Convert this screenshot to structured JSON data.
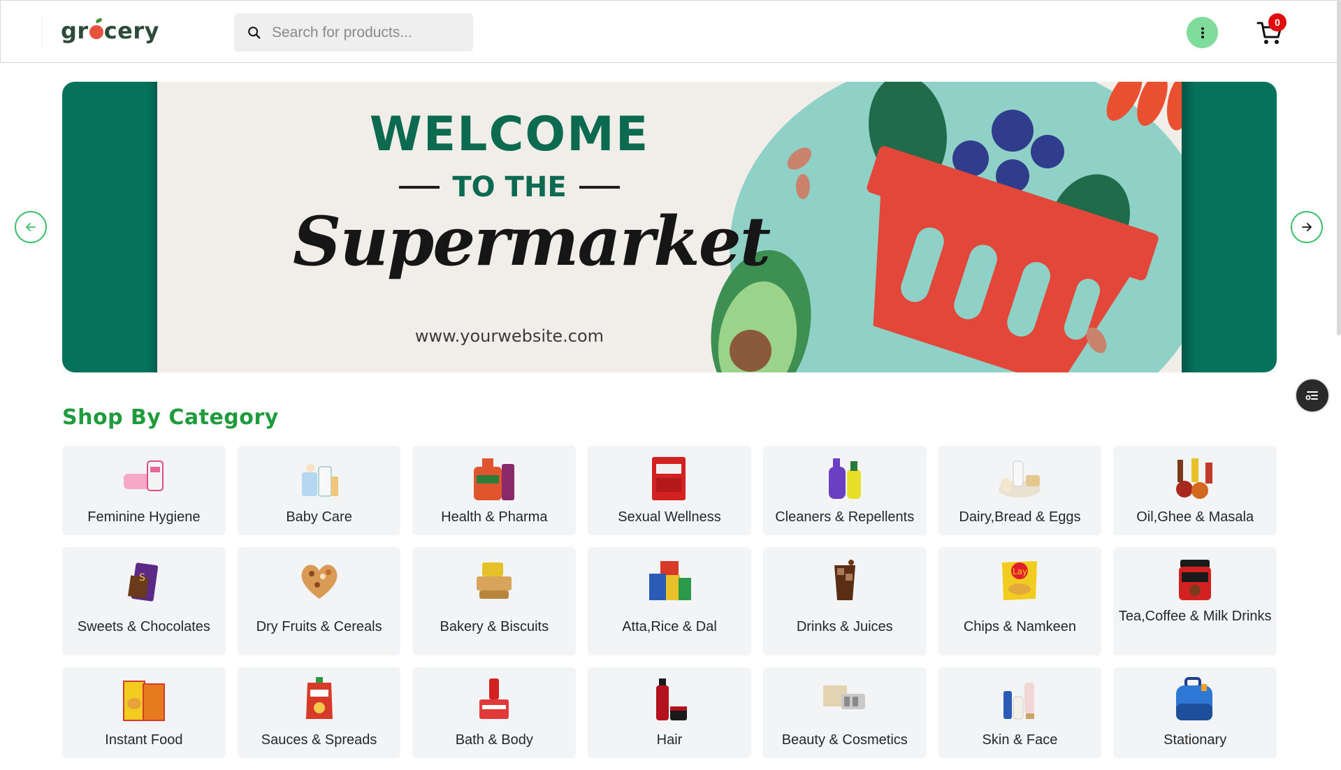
{
  "header": {
    "logo": {
      "part1": "gr",
      "part2": "cery"
    },
    "search": {
      "placeholder": "Search for products..."
    },
    "cart": {
      "count": "0"
    }
  },
  "banner": {
    "headline": "WELCOME",
    "subline": "TO THE",
    "script": "Supermarket",
    "website": "www.yourwebsite.com",
    "colors": {
      "frame": "#05725c",
      "background": "#f1eeea",
      "circle": "#8fd1c6"
    }
  },
  "category": {
    "title": "Shop By Category",
    "rows": [
      [
        {
          "label": "Feminine Hygiene",
          "icon": "feminine-hygiene-product"
        },
        {
          "label": "Baby Care",
          "icon": "baby-care-product"
        },
        {
          "label": "Health & Pharma",
          "icon": "health-pharma-product"
        },
        {
          "label": "Sexual Wellness",
          "icon": "sexual-wellness-product"
        },
        {
          "label": "Cleaners & Repellents",
          "icon": "cleaner-bottles"
        },
        {
          "label": "Dairy,Bread & Eggs",
          "icon": "dairy-items"
        },
        {
          "label": "Oil,Ghee & Masala",
          "icon": "oil-masala-items"
        }
      ],
      [
        {
          "label": "Sweets & Chocolates",
          "icon": "chocolate-bar"
        },
        {
          "label": "Dry Fruits & Cereals",
          "icon": "dry-fruit-heart"
        },
        {
          "label": "Bakery & Biscuits",
          "icon": "bakery-items"
        },
        {
          "label": "Atta,Rice & Dal",
          "icon": "grain-packets"
        },
        {
          "label": "Drinks & Juices",
          "icon": "drink-glass"
        },
        {
          "label": "Chips & Namkeen",
          "icon": "chips-packet"
        },
        {
          "label": "Tea,Coffee & Milk Drinks",
          "icon": "coffee-jar"
        }
      ],
      [
        {
          "label": "Instant Food",
          "icon": "noodle-packets"
        },
        {
          "label": "Sauces & Spreads",
          "icon": "sauce-pouch"
        },
        {
          "label": "Bath & Body",
          "icon": "bath-products"
        },
        {
          "label": "Hair",
          "icon": "hair-products"
        },
        {
          "label": "Beauty & Cosmetics",
          "icon": "cosmetics-box"
        },
        {
          "label": "Skin & Face",
          "icon": "skincare-bottles"
        },
        {
          "label": "Stationary",
          "icon": "school-bag"
        }
      ]
    ]
  }
}
